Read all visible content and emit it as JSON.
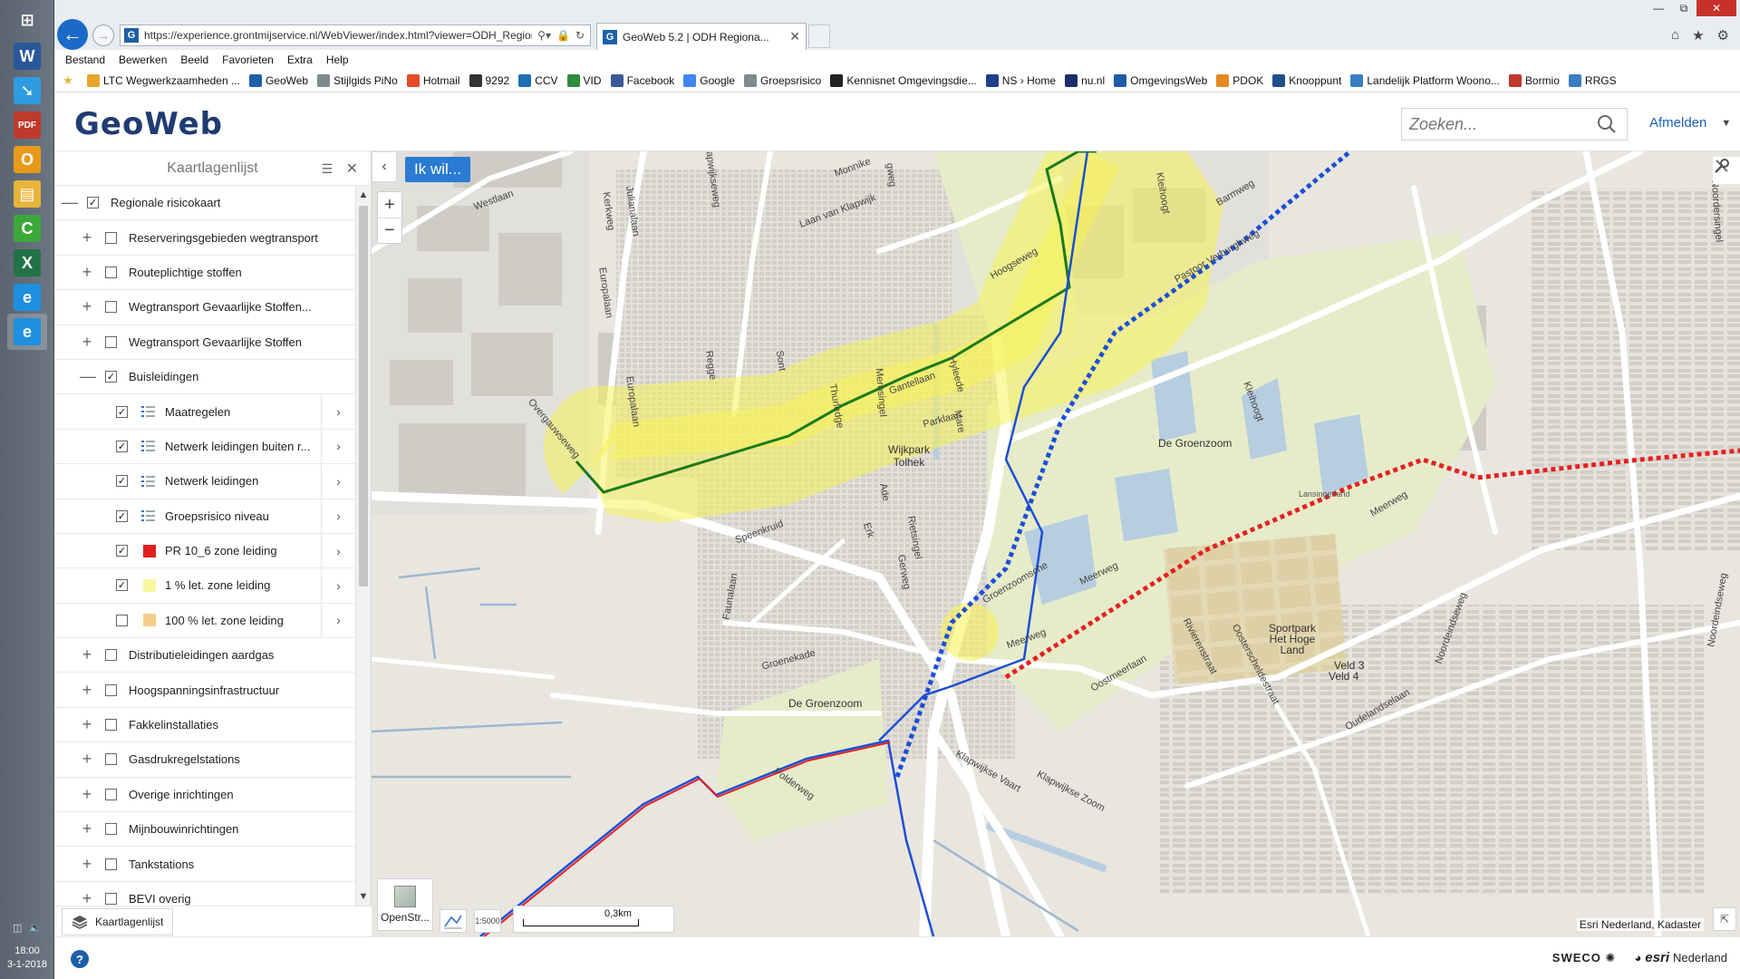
{
  "taskbar": {
    "apps": [
      {
        "name": "windows-start-icon",
        "glyph": "⊞",
        "color": "#5a6470"
      },
      {
        "name": "word-icon",
        "glyph": "W",
        "color": "#2b579a"
      },
      {
        "name": "blue-arrow-app-icon",
        "glyph": "➘",
        "color": "#2f9be0"
      },
      {
        "name": "pdf-icon",
        "glyph": "PDF",
        "color": "#c0392b"
      },
      {
        "name": "outlook-icon",
        "glyph": "O",
        "color": "#e79a1a"
      },
      {
        "name": "file-explorer-icon",
        "glyph": "▤",
        "color": "#e8b53a"
      },
      {
        "name": "c-app-icon",
        "glyph": "C",
        "color": "#3da83a"
      },
      {
        "name": "excel-icon",
        "glyph": "X",
        "color": "#217346"
      },
      {
        "name": "ie-icon",
        "glyph": "e",
        "color": "#1e90e0"
      },
      {
        "name": "ie-active-icon",
        "glyph": "e",
        "color": "#1e90e0"
      }
    ],
    "clock_time": "18:00",
    "clock_date": "3-1-2018"
  },
  "browser": {
    "address": "https://experience.grontmijservice.nl/WebViewer/index.html?viewer=ODH_Regior",
    "address_host": "grontmijservice.nl",
    "tab_title": "GeoWeb 5.2 | ODH Regiona...",
    "menu": [
      "Bestand",
      "Bewerken",
      "Beeld",
      "Favorieten",
      "Extra",
      "Help"
    ],
    "favorites": [
      {
        "label": "LTC Wegwerkzaamheden ...",
        "icon": "ltc-icon",
        "color": "#e7a52a"
      },
      {
        "label": "GeoWeb",
        "icon": "geoweb-g-icon",
        "color": "#1d5fa8"
      },
      {
        "label": "Stijlgids PiNo",
        "icon": "page-icon",
        "color": "#7f8c8d"
      },
      {
        "label": "Hotmail",
        "icon": "msn-icon",
        "color": "#e54b29"
      },
      {
        "label": "9292",
        "icon": "9292-icon",
        "color": "#333333"
      },
      {
        "label": "CCV",
        "icon": "ccv-icon",
        "color": "#1e6fb6"
      },
      {
        "label": "VID",
        "icon": "vid-icon",
        "color": "#2e8b3a"
      },
      {
        "label": "Facebook",
        "icon": "facebook-icon",
        "color": "#3b5998"
      },
      {
        "label": "Google",
        "icon": "google-icon",
        "color": "#4285f4"
      },
      {
        "label": "Groepsrisico",
        "icon": "page-icon",
        "color": "#7f8c8d"
      },
      {
        "label": "Kennisnet Omgevingsdie...",
        "icon": "kennisnet-icon",
        "color": "#222222"
      },
      {
        "label": "NS › Home",
        "icon": "ns-icon",
        "color": "#1f3f8a"
      },
      {
        "label": "nu.nl",
        "icon": "nu-icon",
        "color": "#1c2f6b"
      },
      {
        "label": "OmgevingsWeb",
        "icon": "omgevingsweb-icon",
        "color": "#1f5aa6"
      },
      {
        "label": "PDOK",
        "icon": "pdok-icon",
        "color": "#e48a1f"
      },
      {
        "label": "Knooppunt",
        "icon": "knooppunt-icon",
        "color": "#1f4f8a"
      },
      {
        "label": "Landelijk Platform Woono...",
        "icon": "pw-icon",
        "color": "#3a7fc4"
      },
      {
        "label": "Bormio",
        "icon": "bormio-icon",
        "color": "#c0392b"
      },
      {
        "label": "RRGS",
        "icon": "rrgs-icon",
        "color": "#3a7fc4"
      }
    ]
  },
  "app": {
    "logo": "GeoWeb",
    "search_placeholder": "Zoeken...",
    "logout_label": "Afmelden"
  },
  "panel": {
    "title": "Kaartlagenlijst",
    "footer_tab": "Kaartlagenlijst",
    "layers": [
      {
        "label": "Regionale risicokaart",
        "level": 0,
        "expander": "—",
        "checked": true,
        "kind": "group"
      },
      {
        "label": "Reserveringsgebieden wegtransport",
        "level": 1,
        "expander": "+",
        "checked": false,
        "kind": "group"
      },
      {
        "label": "Routeplichtige stoffen",
        "level": 1,
        "expander": "+",
        "checked": false,
        "kind": "group"
      },
      {
        "label": "Wegtransport Gevaarlijke Stoffen...",
        "level": 1,
        "expander": "+",
        "checked": false,
        "kind": "group"
      },
      {
        "label": "Wegtransport Gevaarlijke Stoffen",
        "level": 1,
        "expander": "+",
        "checked": false,
        "kind": "group"
      },
      {
        "label": "Buisleidingen",
        "level": 1,
        "expander": "—",
        "checked": true,
        "kind": "group"
      },
      {
        "label": "Maatregelen",
        "level": 2,
        "checked": true,
        "kind": "legend"
      },
      {
        "label": "Netwerk leidingen buiten r...",
        "level": 2,
        "checked": true,
        "kind": "legend"
      },
      {
        "label": "Netwerk leidingen",
        "level": 2,
        "checked": true,
        "kind": "legend"
      },
      {
        "label": "Groepsrisico niveau",
        "level": 2,
        "checked": true,
        "kind": "legend"
      },
      {
        "label": "PR 10_6 zone leiding",
        "level": 2,
        "checked": true,
        "kind": "swatch",
        "color": "#e02020"
      },
      {
        "label": "1 % let. zone leiding",
        "level": 2,
        "checked": true,
        "kind": "swatch",
        "color": "#fbf7a0"
      },
      {
        "label": "100 % let. zone leiding",
        "level": 2,
        "checked": false,
        "kind": "swatch",
        "color": "#f6cd8a"
      },
      {
        "label": "Distributieleidingen aardgas",
        "level": 1,
        "expander": "+",
        "checked": false,
        "kind": "group"
      },
      {
        "label": "Hoogspanningsinfrastructuur",
        "level": 1,
        "expander": "+",
        "checked": false,
        "kind": "group"
      },
      {
        "label": "Fakkelinstallaties",
        "level": 1,
        "expander": "+",
        "checked": false,
        "kind": "group"
      },
      {
        "label": "Gasdrukregelstations",
        "level": 1,
        "expander": "+",
        "checked": false,
        "kind": "group"
      },
      {
        "label": "Overige inrichtingen",
        "level": 1,
        "expander": "+",
        "checked": false,
        "kind": "group"
      },
      {
        "label": "Mijnbouwinrichtingen",
        "level": 1,
        "expander": "+",
        "checked": false,
        "kind": "group"
      },
      {
        "label": "Tankstations",
        "level": 1,
        "expander": "+",
        "checked": false,
        "kind": "group"
      },
      {
        "label": "BEVI overig",
        "level": 1,
        "expander": "+",
        "checked": false,
        "kind": "group"
      }
    ]
  },
  "map": {
    "ik_wil_label": "Ik wil...",
    "basemap_label": "OpenStr...",
    "scale_label": "0,3km",
    "scale_button": "1:5000",
    "attribution": "Esri Nederland, Kadaster",
    "labels": {
      "westlaan": "Westlaan",
      "kerkweg": "Kerkweg",
      "julianalaan": "Julianalaan",
      "europalaan": "Europalaan",
      "europalaan2": "Europalaan",
      "laan_van_klapwijk": "Laan van Klapwijk",
      "monnikenweg": "Monnike",
      "hoogseweg": "Hoogseweg",
      "kleihoogt": "Kleihoogt",
      "barmweg": "Barmweg",
      "pastoor": "Pastoor Verburghweg",
      "noordersingel": "Noordersingel",
      "kleihoogt2": "Kleihoogt",
      "overgauwseweg": "Overgauwseweg",
      "gantellaan": "Gantellaan",
      "parklaan": "Parklaan",
      "wijkpark": "Wijkpark\nTolhek",
      "de_groenzoom": "De Groenzoom",
      "lansingerland": "Lansingerland",
      "meerweg": "Meerweg",
      "speenkruid": "Speenkruid",
      "faunalaan": "Faunalaan",
      "groenekade": "Groenekade",
      "de_groenzoom2": "De Groenzoom",
      "oostmeerlaan": "Oostmeerlaan",
      "rivierenstraat": "Rivierenstraat",
      "oosterscheldestraat": "Oosterscheldestraat",
      "sportpark": "Sportpark\nHet Hoge\nLand",
      "veld3": "Veld 3",
      "veld4": "Veld 4",
      "oudelandselaan": "Oudelandselaan",
      "noordeindseweg": "Noordeindseweg",
      "klapwijkse_vaart": "Klapwijkse Vaart",
      "klapwijkse_zoom": "Klapwijkse Zoom",
      "polderweg": "Polderweg",
      "merosingel": "Merosingel",
      "thurledge": "Thurledge",
      "ade": "Ade",
      "erk": "Erk",
      "rietsingel": "Rietsingel",
      "geerweg": "Gerweg",
      "hyleede": "Hyleede",
      "mare": "Mare",
      "groenzoom_road": "Groenzoomsche",
      "meerweg2": "Meerweg",
      "meerweg3": "Meerweg",
      "noordeindseweg2": "Noordeindseweg",
      "klapwijkseweg": "Klapwijkseweg",
      "regge": "Regge",
      "sont": "Sont",
      "hiadeweg": "gweg"
    },
    "colors": {
      "buffer_yellow": "#f6f25a",
      "pipeline_green": "#1a7a1a",
      "blue_line": "#1c4fd6",
      "red_line": "#e52121",
      "park_green": "#e6ecc9",
      "water": "#b7cde0",
      "industrial": "#d8d6d0",
      "residential": "#e4e1da",
      "building": "#cfccc6"
    }
  },
  "footer": {
    "help_label": "?",
    "sweco": "SWECO",
    "esri": "esri",
    "esri_country": "Nederland"
  }
}
